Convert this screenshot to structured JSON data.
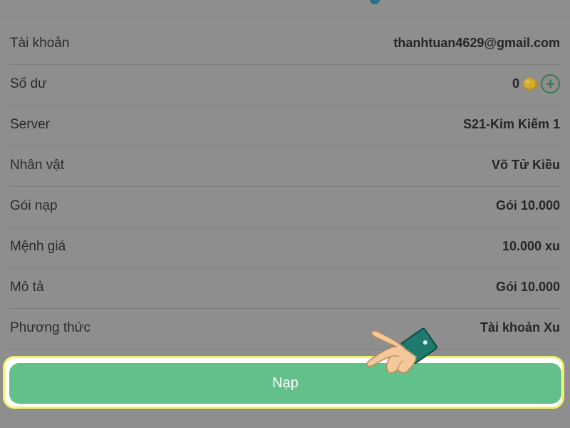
{
  "rows": [
    {
      "label": "Tài khoản",
      "value": "thanhtuan4629@gmail.com"
    },
    {
      "label": "Số dư",
      "value": "0"
    },
    {
      "label": "Server",
      "value": "S21-Kim Kiếm 1"
    },
    {
      "label": "Nhân vật",
      "value": "Võ Tử Kiều"
    },
    {
      "label": "Gói nạp",
      "value": "Gói 10.000"
    },
    {
      "label": "Mệnh giá",
      "value": "10.000 xu"
    },
    {
      "label": "Mô tả",
      "value": "Gói 10.000"
    },
    {
      "label": "Phương thức",
      "value": "Tài khoản Xu"
    }
  ],
  "balance": {
    "coin_icon": "coin-icon",
    "add_symbol": "+",
    "add_icon": "plus-circle-icon"
  },
  "submit": {
    "label": "Nạp"
  },
  "pointer": {
    "icon": "pointing-hand-icon"
  },
  "colors": {
    "overlay": "#8e8e8e",
    "button_green": "#62c08a",
    "highlight_frame": "#f5f06a",
    "coin_gold": "#c9a227",
    "plus_green": "#3a7a50"
  }
}
